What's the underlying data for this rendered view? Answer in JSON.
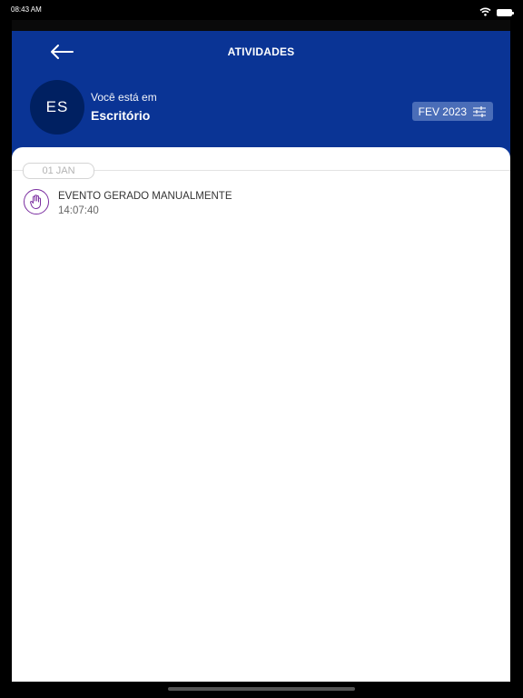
{
  "status_bar": {
    "time": "08:43 AM",
    "wifi_icon": "wifi-icon",
    "battery_icon": "battery-icon"
  },
  "header": {
    "back_icon": "arrow-left-icon",
    "title": "ATIVIDADES",
    "avatar_initials": "ES",
    "location_label": "Você está em",
    "location_name": "Escritório",
    "date_filter_label": "FEV 2023",
    "filter_icon": "sliders-icon",
    "background_color": "#0a3495"
  },
  "activity": {
    "day_label": "01 JAN",
    "events": [
      {
        "icon": "hand-icon",
        "title": "EVENTO GERADO MANUALMENTE",
        "time": "14:07:40",
        "accent_color": "#7a2da0"
      }
    ]
  }
}
